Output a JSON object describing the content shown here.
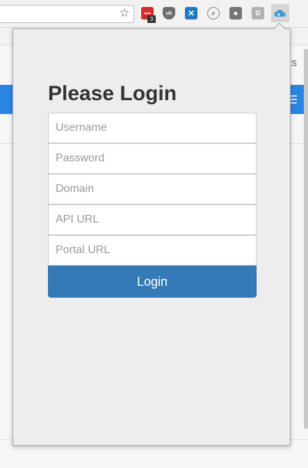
{
  "browser": {
    "bookmark_icon": "star-icon",
    "extensions": [
      {
        "name": "ext-red-icon",
        "badge": "3"
      },
      {
        "name": "ublock-shield-icon",
        "glyph": "ub"
      },
      {
        "name": "blue-ext-icon",
        "glyph": "✕"
      },
      {
        "name": "magnifier-icon",
        "glyph": "⌕"
      },
      {
        "name": "dark-ext-icon",
        "glyph": "■"
      },
      {
        "name": "google-ext-icon",
        "glyph": "G"
      },
      {
        "name": "cloud-ext-icon"
      }
    ]
  },
  "background_page": {
    "partial_text": "s"
  },
  "popup": {
    "title": "Please Login",
    "fields": {
      "username": {
        "placeholder": "Username",
        "value": ""
      },
      "password": {
        "placeholder": "Password",
        "value": ""
      },
      "domain": {
        "placeholder": "Domain",
        "value": ""
      },
      "api_url": {
        "placeholder": "API URL",
        "value": ""
      },
      "portal_url": {
        "placeholder": "Portal URL",
        "value": ""
      }
    },
    "login_label": "Login"
  },
  "colors": {
    "primary_button": "#337ab7",
    "page_blue_bar": "#2b85e4",
    "popup_bg": "#ededed"
  }
}
